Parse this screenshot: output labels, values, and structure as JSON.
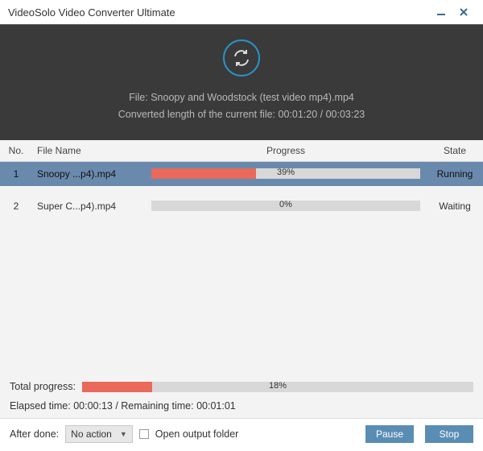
{
  "window": {
    "title": "VideoSolo Video Converter Ultimate"
  },
  "status": {
    "file_label": "File: Snoopy and Woodstock (test video mp4).mp4",
    "converted_label": "Converted length of the current file: 00:01:20 / 00:03:23"
  },
  "columns": {
    "no": "No.",
    "name": "File Name",
    "progress": "Progress",
    "state": "State"
  },
  "rows": [
    {
      "no": "1",
      "name": "Snoopy ...p4).mp4",
      "percent": 39,
      "percent_label": "39%",
      "state": "Running",
      "selected": true
    },
    {
      "no": "2",
      "name": "Super C...p4).mp4",
      "percent": 0,
      "percent_label": "0%",
      "state": "Waiting",
      "selected": false
    }
  ],
  "total": {
    "label": "Total progress:",
    "percent": 18,
    "percent_label": "18%"
  },
  "timing": {
    "text": "Elapsed time: 00:00:13 / Remaining time: 00:01:01"
  },
  "footer": {
    "after_done_label": "After done:",
    "after_done_value": "No action",
    "open_folder_label": "Open output folder",
    "pause": "Pause",
    "stop": "Stop"
  }
}
